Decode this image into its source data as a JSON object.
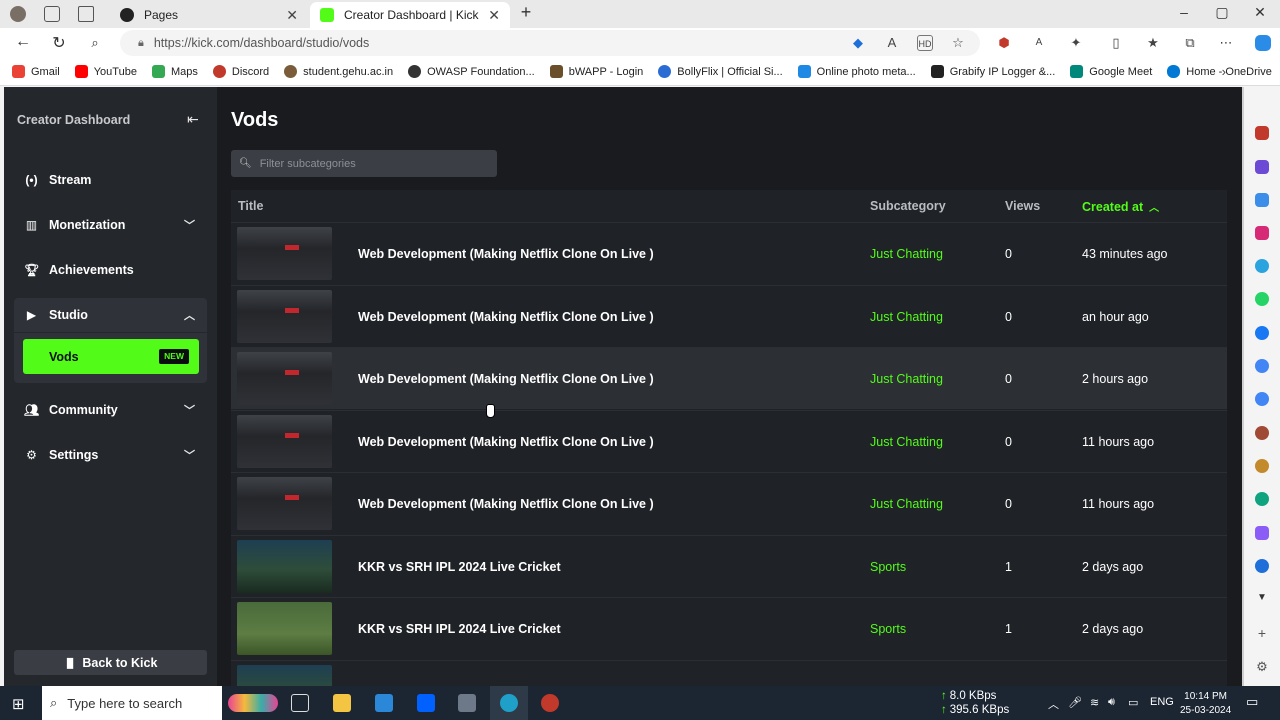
{
  "browser": {
    "tabs": [
      {
        "title": "Pages",
        "favicon": "github-icon",
        "active": false
      },
      {
        "title": "Creator Dashboard | Kick",
        "favicon": "kick-icon",
        "active": true
      }
    ],
    "new_tab": "+",
    "url": "https://kick.com/dashboard/studio/vods",
    "bookmarks": [
      {
        "label": "Gmail",
        "color": "#ea4335"
      },
      {
        "label": "YouTube",
        "color": "#ff0000"
      },
      {
        "label": "Maps",
        "color": "#34a853"
      },
      {
        "label": "Discord",
        "color": "#c0392b"
      },
      {
        "label": "student.gehu.ac.in",
        "color": "#7a5c3a"
      },
      {
        "label": "OWASP Foundation...",
        "color": "#333333"
      },
      {
        "label": "bWAPP - Login",
        "color": "#6b4f2a"
      },
      {
        "label": "BollyFlix | Official Si...",
        "color": "#2b6cd4"
      },
      {
        "label": "Online photo meta...",
        "color": "#1e88e5"
      },
      {
        "label": "Grabify IP Logger &...",
        "color": "#222222"
      },
      {
        "label": "Google Meet",
        "color": "#00897b"
      },
      {
        "label": "Home - OneDrive",
        "color": "#0078d4"
      }
    ]
  },
  "sidebar": {
    "title": "Creator Dashboard",
    "items": [
      {
        "label": "Stream",
        "icon": "broadcast-icon"
      },
      {
        "label": "Monetization",
        "icon": "chart-icon"
      },
      {
        "label": "Achievements",
        "icon": "trophy-icon"
      },
      {
        "label": "Studio",
        "icon": "studio-icon"
      },
      {
        "label": "Community",
        "icon": "users-icon"
      },
      {
        "label": "Settings",
        "icon": "gear-icon"
      }
    ],
    "sub_item": {
      "label": "Vods",
      "badge": "NEW"
    },
    "back_label": "Back to Kick"
  },
  "main": {
    "title": "Vods",
    "filter_placeholder": "Filter subcategories",
    "columns": {
      "title": "Title",
      "subcategory": "Subcategory",
      "views": "Views",
      "created": "Created at"
    },
    "rows": [
      {
        "title": "Web Development (Making Netflix Clone On Live )",
        "subcategory": "Just Chatting",
        "views": "0",
        "created": "43 minutes ago"
      },
      {
        "title": "Web Development (Making Netflix Clone On Live )",
        "subcategory": "Just Chatting",
        "views": "0",
        "created": "an hour ago"
      },
      {
        "title": "Web Development (Making Netflix Clone On Live )",
        "subcategory": "Just Chatting",
        "views": "0",
        "created": "2 hours ago"
      },
      {
        "title": "Web Development (Making Netflix Clone On Live )",
        "subcategory": "Just Chatting",
        "views": "0",
        "created": "11 hours ago"
      },
      {
        "title": "Web Development (Making Netflix Clone On Live )",
        "subcategory": "Just Chatting",
        "views": "0",
        "created": "11 hours ago"
      },
      {
        "title": "KKR vs SRH IPL 2024 Live Cricket",
        "subcategory": "Sports",
        "views": "1",
        "created": "2 days ago"
      },
      {
        "title": "KKR vs SRH IPL 2024 Live Cricket",
        "subcategory": "Sports",
        "views": "1",
        "created": "2 days ago"
      }
    ]
  },
  "taskbar": {
    "search_placeholder": "Type here to search",
    "net_up": "8.0 KBps",
    "net_down": "395.6 KBps",
    "lang": "ENG",
    "time": "10:14 PM",
    "date": "25-03-2024"
  },
  "colors": {
    "accent": "#53fc18",
    "sidebar_bg": "#24272c",
    "page_bg": "#191b1f"
  }
}
